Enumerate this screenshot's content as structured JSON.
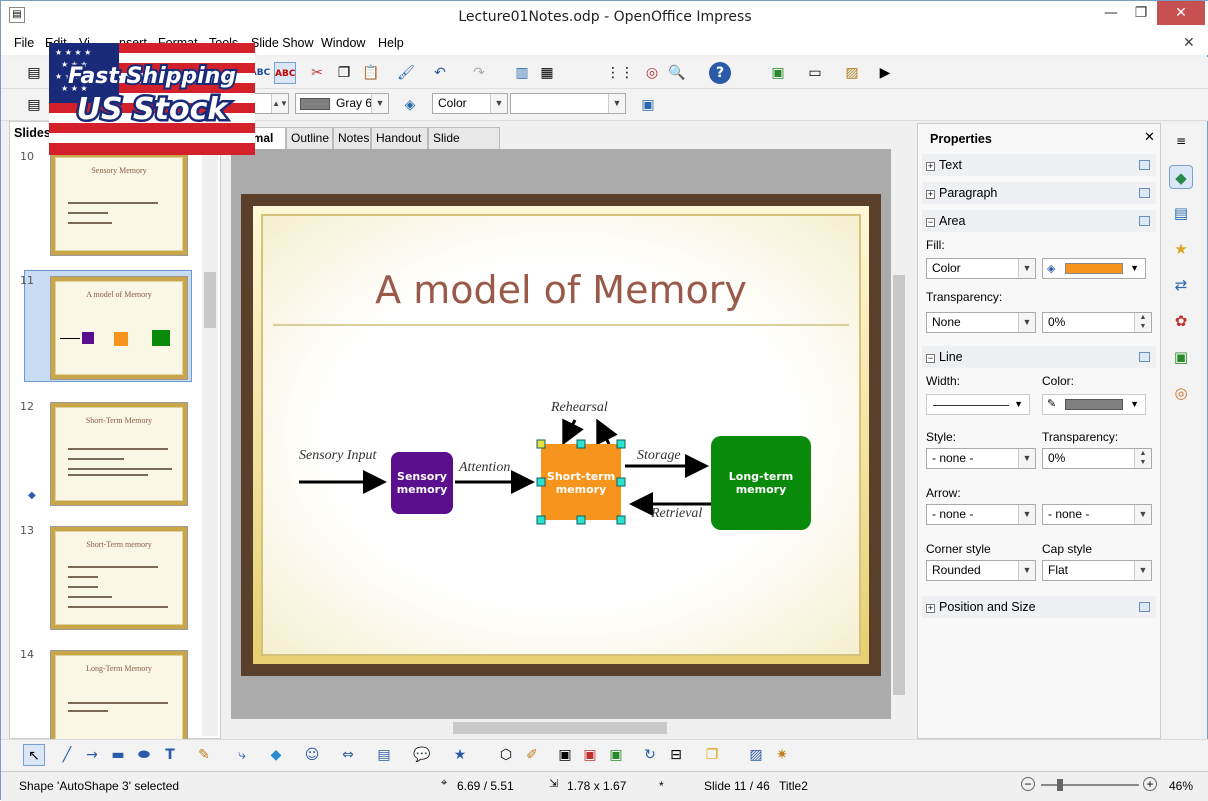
{
  "window": {
    "title": "Lecture01Notes.odp - OpenOffice Impress"
  },
  "menu": [
    "File",
    "Edit",
    "View",
    "Insert",
    "Format",
    "Tools",
    "Slide Show",
    "Window",
    "Help"
  ],
  "menu_visible": [
    "File",
    "Edit",
    "Vi",
    "nsert",
    "Format",
    "Tools",
    "Slide Show",
    "Window",
    "Help"
  ],
  "toolbar2": {
    "line_color": "Gray 6",
    "area_style": "Color",
    "area_value": ""
  },
  "slides_panel": {
    "title": "Slides",
    "thumbs": [
      {
        "num": "10",
        "title": "Sensory Memory"
      },
      {
        "num": "11",
        "title": "A model of Memory"
      },
      {
        "num": "12",
        "title": "Short-Term Memory"
      },
      {
        "num": "13",
        "title": "Short-Term memory"
      },
      {
        "num": "14",
        "title": "Long-Term Memory"
      }
    ]
  },
  "view_tabs": [
    "rmal",
    "Outline",
    "Notes",
    "Handout",
    "Slide Sorter"
  ],
  "slide": {
    "title": "A model of Memory",
    "labels": {
      "sensory_input": "Sensory Input",
      "attention": "Attention",
      "rehearsal": "Rehearsal",
      "storage": "Storage",
      "retrieval": "Retrieval"
    },
    "boxes": {
      "sensory": "Sensory memory",
      "short": "Short-term memory",
      "long": "Long-term memory"
    },
    "colors": {
      "sensory": "#5a0f8c",
      "short": "#f7941d",
      "long": "#0a8a0a",
      "title": "#9a5a4a"
    }
  },
  "properties": {
    "title": "Properties",
    "text": "Text",
    "paragraph": "Paragraph",
    "area": "Area",
    "fill_label": "Fill:",
    "fill_value": "Color",
    "fill_color": "#f7941d",
    "transparency_label": "Transparency:",
    "transparency_value": "None",
    "transparency_pct": "0%",
    "line": "Line",
    "width_label": "Width:",
    "color_label": "Color:",
    "style_label": "Style:",
    "style_value": "- none -",
    "line_transp_label": "Transparency:",
    "line_transp_value": "0%",
    "arrow_label": "Arrow:",
    "arrow_start": "- none -",
    "arrow_end": "- none -",
    "corner_label": "Corner style",
    "corner_value": "Rounded",
    "cap_label": "Cap style",
    "cap_value": "Flat",
    "position": "Position and Size"
  },
  "status": {
    "selection": "Shape 'AutoShape 3' selected",
    "position": "6.69 / 5.51",
    "size": "1.78 x 1.67",
    "modified": "*",
    "slide": "Slide 11 / 46",
    "layout": "Title2",
    "zoom": "46%"
  },
  "banner": {
    "line1": "Fast Shipping",
    "line2": "US Stock"
  }
}
